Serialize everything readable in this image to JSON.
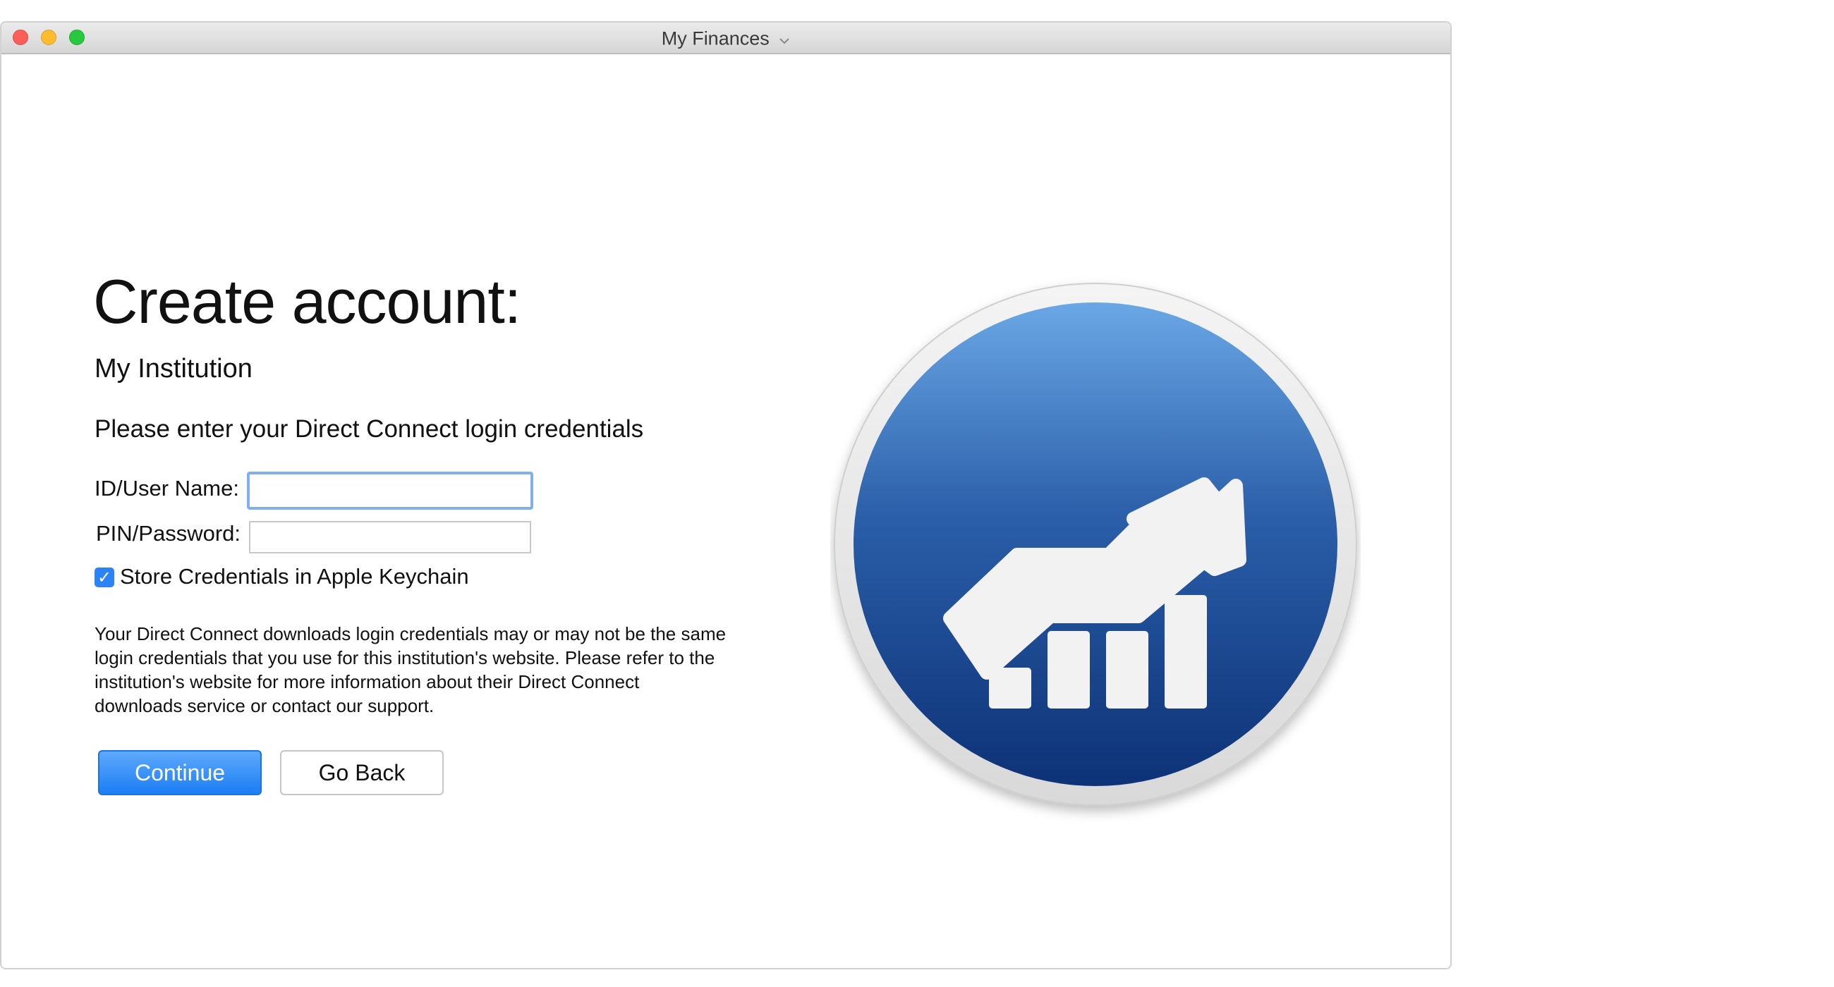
{
  "window": {
    "title": "My Finances",
    "title_menu_icon": "chevron-down-icon"
  },
  "page": {
    "heading": "Create account:",
    "institution": "My Institution",
    "instruction": "Please enter your Direct Connect login credentials"
  },
  "form": {
    "user_label": "ID/User Name:",
    "user_value": "",
    "password_label": "PIN/Password:",
    "password_value": "",
    "store_credentials_label": "Store Credentials in Apple Keychain",
    "store_credentials_checked": true
  },
  "note": "Your Direct Connect downloads login credentials may or may not be the same\nlogin credentials that you use for this institution's website.  Please refer to the\ninstitution's website for more information about their Direct Connect\ndownloads service or contact our support.",
  "buttons": {
    "continue": "Continue",
    "go_back": "Go Back"
  },
  "icon": {
    "name": "finance-growth-icon",
    "colors": {
      "ring": "#e6e6e6",
      "gradient_top": "#6aa7e6",
      "gradient_mid": "#2a5ea8",
      "gradient_bottom": "#0d3277",
      "glyph": "#f2f2f2"
    }
  },
  "colors": {
    "accent": "#2b83f5",
    "focus_ring": "#7fb0ea"
  }
}
